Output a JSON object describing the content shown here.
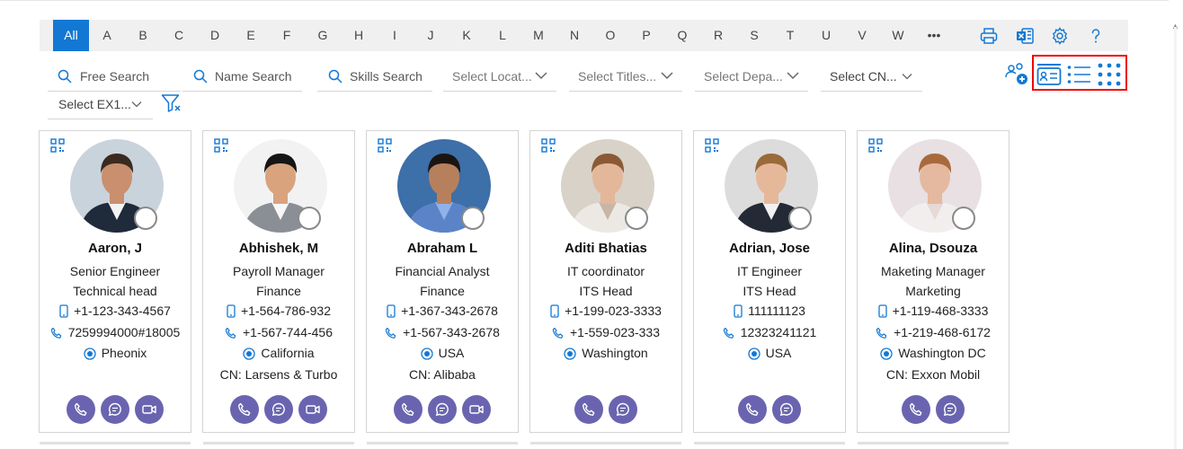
{
  "alphabet": {
    "letters": [
      "All",
      "A",
      "B",
      "C",
      "D",
      "E",
      "F",
      "G",
      "H",
      "I",
      "J",
      "K",
      "L",
      "M",
      "N",
      "O",
      "P",
      "Q",
      "R",
      "S",
      "T",
      "U",
      "V",
      "W",
      "•••"
    ],
    "active": "All"
  },
  "toolbar_icons": [
    "printer-icon",
    "excel-icon",
    "gear-icon",
    "help-icon"
  ],
  "search": {
    "free": "Free Search",
    "name": "Name Search",
    "skills": "Skills Search",
    "location": "Select Locat...",
    "titles": "Select Titles...",
    "departments": "Select Depa...",
    "cn": "Select CN...",
    "ex1": "Select EX1..."
  },
  "view_icons": [
    "add-people-icon",
    "card-view-icon",
    "list-view-icon",
    "grid-view-icon"
  ],
  "colors": {
    "accent": "#1278d4",
    "action": "#6a64b0",
    "highlight": "#e00000"
  },
  "cards": [
    {
      "name": "Aaron, J",
      "title": "Senior Engineer",
      "dept": "Technical head",
      "mobile": "+1-123-343-4567",
      "phone": "7259994000#18005",
      "location": "Pheonix",
      "cn": "",
      "actions": [
        "call",
        "chat",
        "video"
      ]
    },
    {
      "name": "Abhishek, M",
      "title": "Payroll Manager",
      "dept": "Finance",
      "mobile": "+1-564-786-932",
      "phone": "+1-567-744-456",
      "location": "California",
      "cn": "CN: Larsens & Turbo",
      "actions": [
        "call",
        "chat",
        "video"
      ]
    },
    {
      "name": "Abraham L",
      "title": "Financial Analyst",
      "dept": "Finance",
      "mobile": "+1-367-343-2678",
      "phone": "+1-567-343-2678",
      "location": "USA",
      "cn": "CN: Alibaba",
      "actions": [
        "call",
        "chat",
        "video"
      ]
    },
    {
      "name": "Aditi Bhatias",
      "title": "IT coordinator",
      "dept": "ITS Head",
      "mobile": "+1-199-023-3333",
      "phone": "+1-559-023-333",
      "location": "Washington",
      "cn": "",
      "actions": [
        "call",
        "chat"
      ]
    },
    {
      "name": "Adrian, Jose",
      "title": "IT Engineer",
      "dept": "ITS Head",
      "mobile": "111111123",
      "phone": "12323241121",
      "location": "USA",
      "cn": "",
      "actions": [
        "call",
        "chat"
      ]
    },
    {
      "name": "Alina, Dsouza",
      "title": "Maketing Manager",
      "dept": "Marketing",
      "mobile": "+1-119-468-3333",
      "phone": "+1-219-468-6172",
      "location": "Washington DC",
      "cn": "CN: Exxon Mobil",
      "actions": [
        "call",
        "chat"
      ]
    }
  ]
}
